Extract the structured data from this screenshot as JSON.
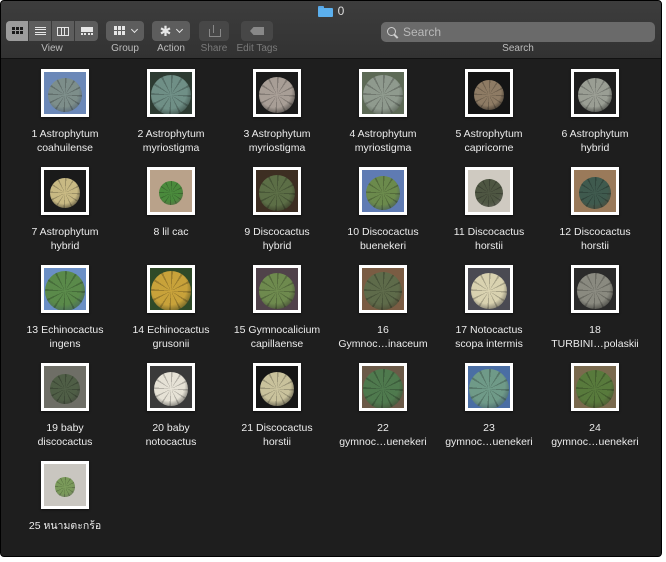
{
  "window": {
    "title": "0"
  },
  "toolbar": {
    "view_label": "View",
    "group_label": "Group",
    "action_label": "Action",
    "share_label": "Share",
    "edit_tags_label": "Edit Tags",
    "search_label": "Search",
    "search_placeholder": "Search",
    "view_modes": [
      {
        "name": "icon-view",
        "active": true
      },
      {
        "name": "list-view",
        "active": false
      },
      {
        "name": "column-view",
        "active": false
      },
      {
        "name": "gallery-view",
        "active": false
      }
    ]
  },
  "files": [
    {
      "line1": "1 Astrophytum",
      "line2": "coahuilense",
      "bg": "#6b88b8",
      "plant": "#7d8e8a",
      "size": 34
    },
    {
      "line1": "2 Astrophytum",
      "line2": "myriostigma",
      "bg": "#2d3b32",
      "plant": "#6f8f86",
      "size": 40
    },
    {
      "line1": "3 Astrophytum",
      "line2": "myriostigma",
      "bg": "#1a1a1a",
      "plant": "#a89e96",
      "size": 36
    },
    {
      "line1": "4 Astrophytum",
      "line2": "myriostigma",
      "bg": "#5d6a56",
      "plant": "#8f9a8e",
      "size": 40
    },
    {
      "line1": "5 Astrophytum",
      "line2": "capricorne",
      "bg": "#141414",
      "plant": "#8e7b64",
      "size": 30
    },
    {
      "line1": "6 Astrophytum",
      "line2": "hybrid",
      "bg": "#1e1e1e",
      "plant": "#9a9e94",
      "size": 34
    },
    {
      "line1": "7 Astrophytum",
      "line2": "hybrid",
      "bg": "#1a1a1a",
      "plant": "#c8b983",
      "size": 30
    },
    {
      "line1": "8 lil cac",
      "line2": "",
      "bg": "#b9a28a",
      "plant": "#4a8a3c",
      "size": 24
    },
    {
      "line1": "9 Discocactus",
      "line2": "hybrid",
      "bg": "#3d2e22",
      "plant": "#5c6e46",
      "size": 36
    },
    {
      "line1": "10 Discocactus",
      "line2": "buenekeri",
      "bg": "#5f7bb3",
      "plant": "#6b8a4c",
      "size": 34
    },
    {
      "line1": "11 Discocactus",
      "line2": "horstii",
      "bg": "#cfcac1",
      "plant": "#4e5642",
      "size": 28
    },
    {
      "line1": "12 Discocactus",
      "line2": "horstii",
      "bg": "#9a7a5a",
      "plant": "#3f5a4e",
      "size": 32
    },
    {
      "line1": "13 Echinocactus",
      "line2": "ingens",
      "bg": "#6a8fc6",
      "plant": "#5a8a4a",
      "size": 40
    },
    {
      "line1": "14 Echinocactus",
      "line2": "grusonii",
      "bg": "#2f4a28",
      "plant": "#c8a23a",
      "size": 40
    },
    {
      "line1": "15 Gymnocalicium",
      "line2": "capillaense",
      "bg": "#50424a",
      "plant": "#6e8a4e",
      "size": 36
    },
    {
      "line1": "16",
      "line2": "Gymnoc…inaceum",
      "bg": "#7a5c43",
      "plant": "#5e6b4a",
      "size": 38
    },
    {
      "line1": "17 Notocactus",
      "line2": "scopa intermis",
      "bg": "#4a4a52",
      "plant": "#d9d2b0",
      "size": 36
    },
    {
      "line1": "18",
      "line2": "TURBINI…polaskii",
      "bg": "#2a2a2a",
      "plant": "#8a8a80",
      "size": 36
    },
    {
      "line1": "19 baby",
      "line2": "discocactus",
      "bg": "#6e6e66",
      "plant": "#4f5e46",
      "size": 30
    },
    {
      "line1": "20 baby",
      "line2": "notocactus",
      "bg": "#3a3a3a",
      "plant": "#e6e2d6",
      "size": 34
    },
    {
      "line1": "21 Discocactus",
      "line2": "horstii",
      "bg": "#151515",
      "plant": "#c9c29c",
      "size": 34
    },
    {
      "line1": "22",
      "line2": "gymnoc…uenekeri",
      "bg": "#6b5a48",
      "plant": "#4f7a4e",
      "size": 40
    },
    {
      "line1": "23",
      "line2": "gymnoc…uenekeri",
      "bg": "#4a6ea4",
      "plant": "#6f9a88",
      "size": 40
    },
    {
      "line1": "24",
      "line2": "gymnoc…uenekeri",
      "bg": "#7a6a4e",
      "plant": "#587a3c",
      "size": 38
    },
    {
      "line1": "25 หนามตะกร้อ",
      "line2": "",
      "bg": "#c9c6c0",
      "plant": "#7a9a5a",
      "size": 20
    }
  ]
}
